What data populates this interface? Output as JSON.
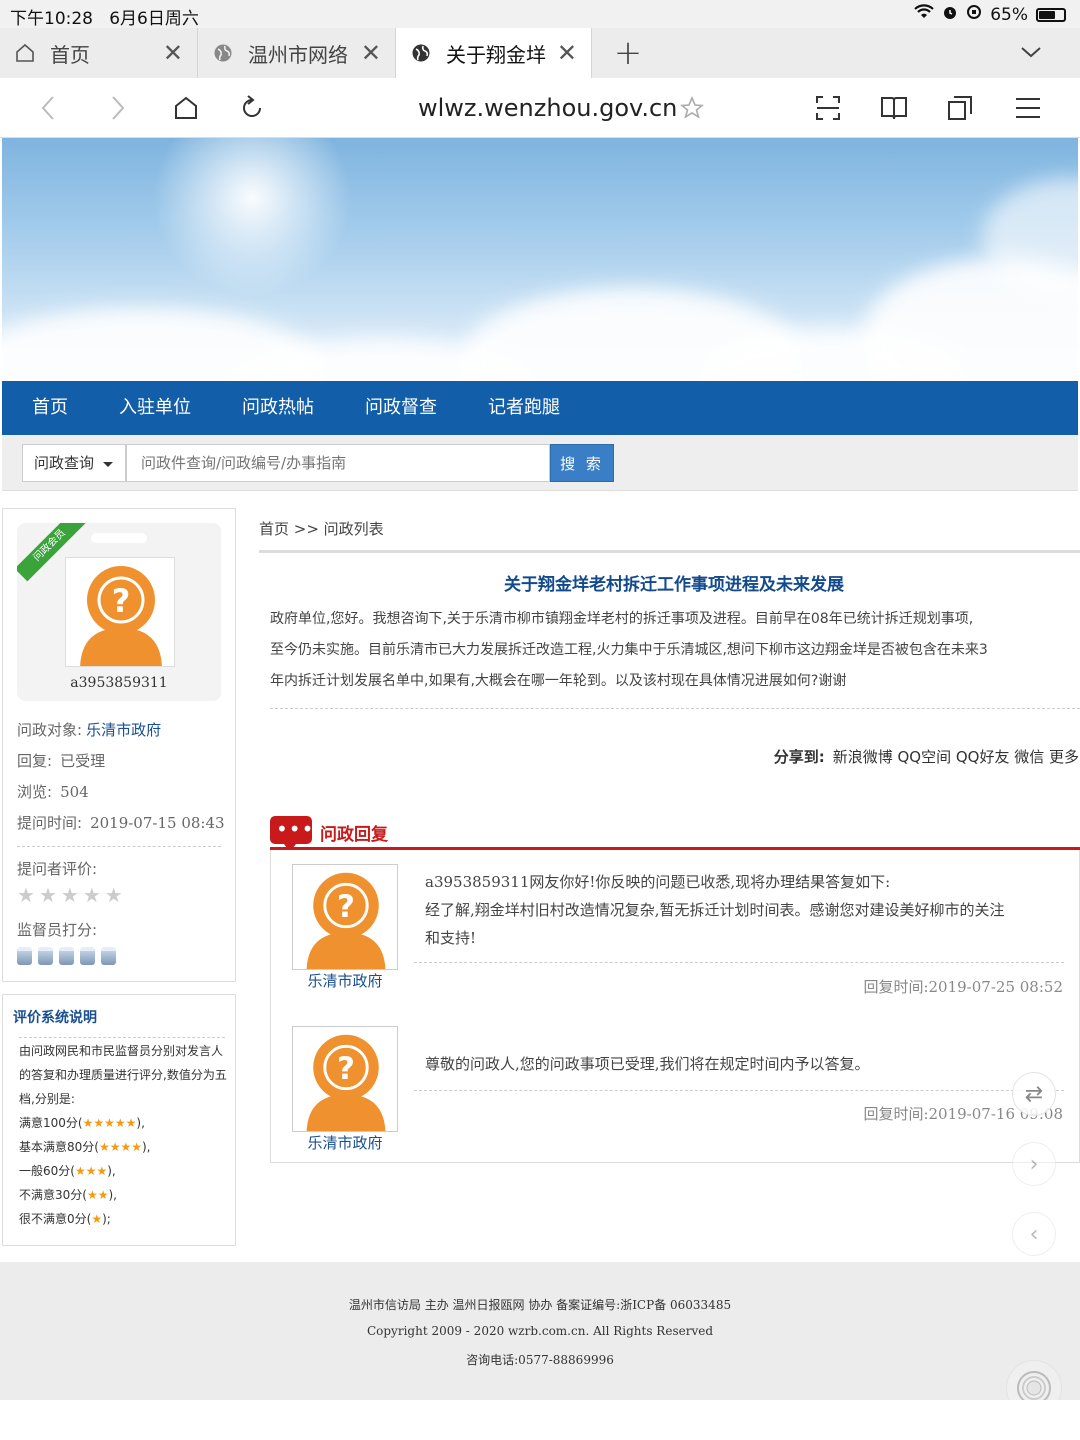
{
  "status": {
    "time": "下午10:28",
    "date": "6月6日周六",
    "battery": "65%",
    "battery_level": 0.65
  },
  "tabs": [
    {
      "label": "首页",
      "icon": "home-icon"
    },
    {
      "label": "温州市网络",
      "icon": "globe-icon"
    },
    {
      "label": "关于翔金垟",
      "icon": "globe-icon"
    }
  ],
  "address": {
    "url": "wlwz.wenzhou.gov.cn"
  },
  "nav": [
    "首页",
    "入驻单位",
    "问政热帖",
    "问政督查",
    "记者跑腿"
  ],
  "search": {
    "select": "问政查询",
    "placeholder": "问政件查询/问政编号/办事指南",
    "button": "搜 索"
  },
  "user": {
    "badge": "问政会员",
    "name": "a3953859311",
    "target_label": "问政对象:",
    "target": "乐清市政府",
    "reply_label": "回复:",
    "reply": "已受理",
    "views_label": "浏览:",
    "views": "504",
    "time_label": "提问时间:",
    "time": "2019-07-15 08:43",
    "rating_label": "提问者评价:",
    "supervisor_label": "监督员打分:"
  },
  "eval": {
    "title": "评价系统说明",
    "intro": "由问政网民和市民监督员分别对发言人的答复和办理质量进行评分,数值分为五档,分别是:",
    "levels": [
      {
        "text": "满意100分(",
        "stars": 5,
        "end": "),"
      },
      {
        "text": "基本满意80分(",
        "stars": 4,
        "end": "),"
      },
      {
        "text": "一般60分(",
        "stars": 3,
        "end": "),"
      },
      {
        "text": "不满意30分(",
        "stars": 2,
        "end": "),"
      },
      {
        "text": "很不满意0分(",
        "stars": 1,
        "end": ");"
      }
    ]
  },
  "breadcrumb": "首页 >> 问政列表",
  "question": {
    "title": "关于翔金垟老村拆迁工作事项进程及未来发展",
    "lines": [
      "政府单位,您好。我想咨询下,关于乐清市柳市镇翔金垟老村的拆迁事项及进程。目前早在08年已统计拆迁规划事项,",
      "至今仍未实施。目前乐清市已大力发展拆迁改造工程,火力集中于乐清城区,想问下柳市这边翔金垟是否被包含在未来3",
      "年内拆迁计划发展名单中,如果有,大概会在哪一年轮到。以及该村现在具体情况进展如何?谢谢"
    ]
  },
  "share": {
    "label": "分享到:",
    "items": "新浪微博 QQ空间 QQ好友 微信 更多"
  },
  "reply_section": {
    "title": "问政回复",
    "dots": "•••"
  },
  "replies": [
    {
      "org": "乐清市政府",
      "lines": [
        "a3953859311网友你好!你反映的问题已收悉,现将办理结果答复如下:",
        "经了解,翔金垟村旧村改造情况复杂,暂无拆迁计划时间表。感谢您对建设美好柳市的关注",
        "和支持!"
      ],
      "time": "回复时间:2019-07-25 08:52"
    },
    {
      "org": "乐清市政府",
      "lines": [
        "尊敬的问政人,您的问政事项已受理,我们将在规定时间内予以答复。"
      ],
      "time": "回复时间:2019-07-16 09:08"
    }
  ],
  "footer": {
    "line1": "温州市信访局 主办 温州日报瓯网 协办 备案证编号:浙ICP备 06033485",
    "line2": "Copyright 2009 - 2020 wzrb.com.cn. All Rights Reserved",
    "line3": "咨询电话:0577-88869996"
  }
}
